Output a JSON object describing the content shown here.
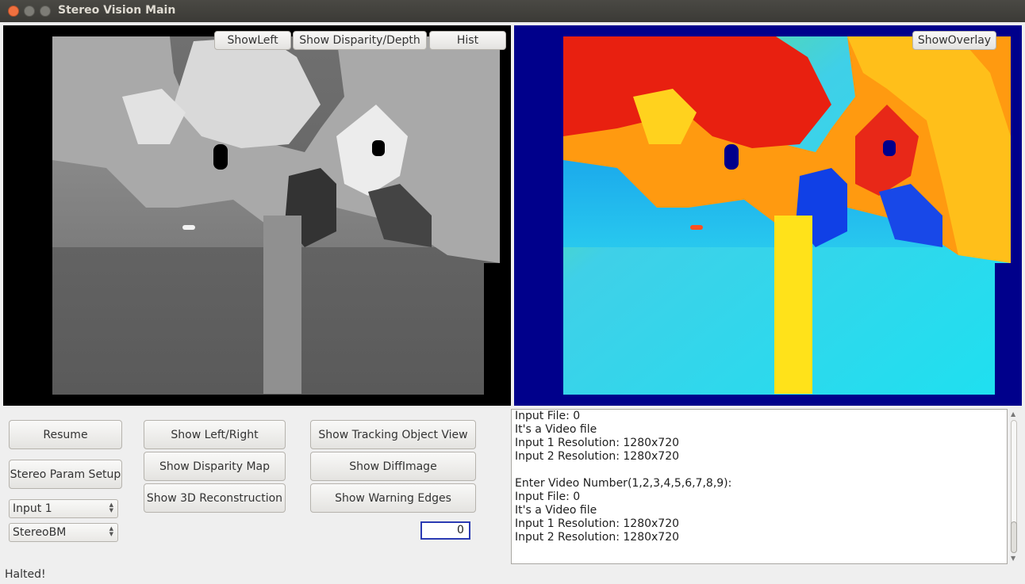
{
  "window": {
    "title": "Stereo Vision Main"
  },
  "left_view": {
    "buttons": {
      "show_left": "ShowLeft",
      "show_disparity": "Show Disparity/Depth",
      "hist": "Hist"
    }
  },
  "right_view": {
    "buttons": {
      "show_overlay": "ShowOverlay"
    }
  },
  "controls": {
    "resume": "Resume",
    "stereo_param_setup": "Stereo Param Setup",
    "input_select": "Input 1",
    "algorithm_select": "StereoBM",
    "show_left_right": "Show Left/Right",
    "show_disparity_map": "Show Disparity Map",
    "show_3d_reconstruction": "Show 3D Reconstruction",
    "show_tracking_object_view": "Show Tracking Object View",
    "show_diffimage": "Show DiffImage",
    "show_warning_edges": "Show Warning Edges",
    "spin_value": "0"
  },
  "log": {
    "lines": [
      "Input File: 0",
      "It's a Video file",
      "Input 1 Resolution: 1280x720",
      "Input 2 Resolution: 1280x720",
      "",
      "Enter Video Number(1,2,3,4,5,6,7,8,9):",
      "Input File: 0",
      "It's a Video file",
      "Input 1 Resolution: 1280x720",
      "Input 2 Resolution: 1280x720"
    ]
  },
  "status": {
    "text": "Halted!"
  },
  "colors": {
    "titlebar": "#3c3b37",
    "overlay_bg": "#00008b",
    "focus": "#2b3bb3"
  }
}
